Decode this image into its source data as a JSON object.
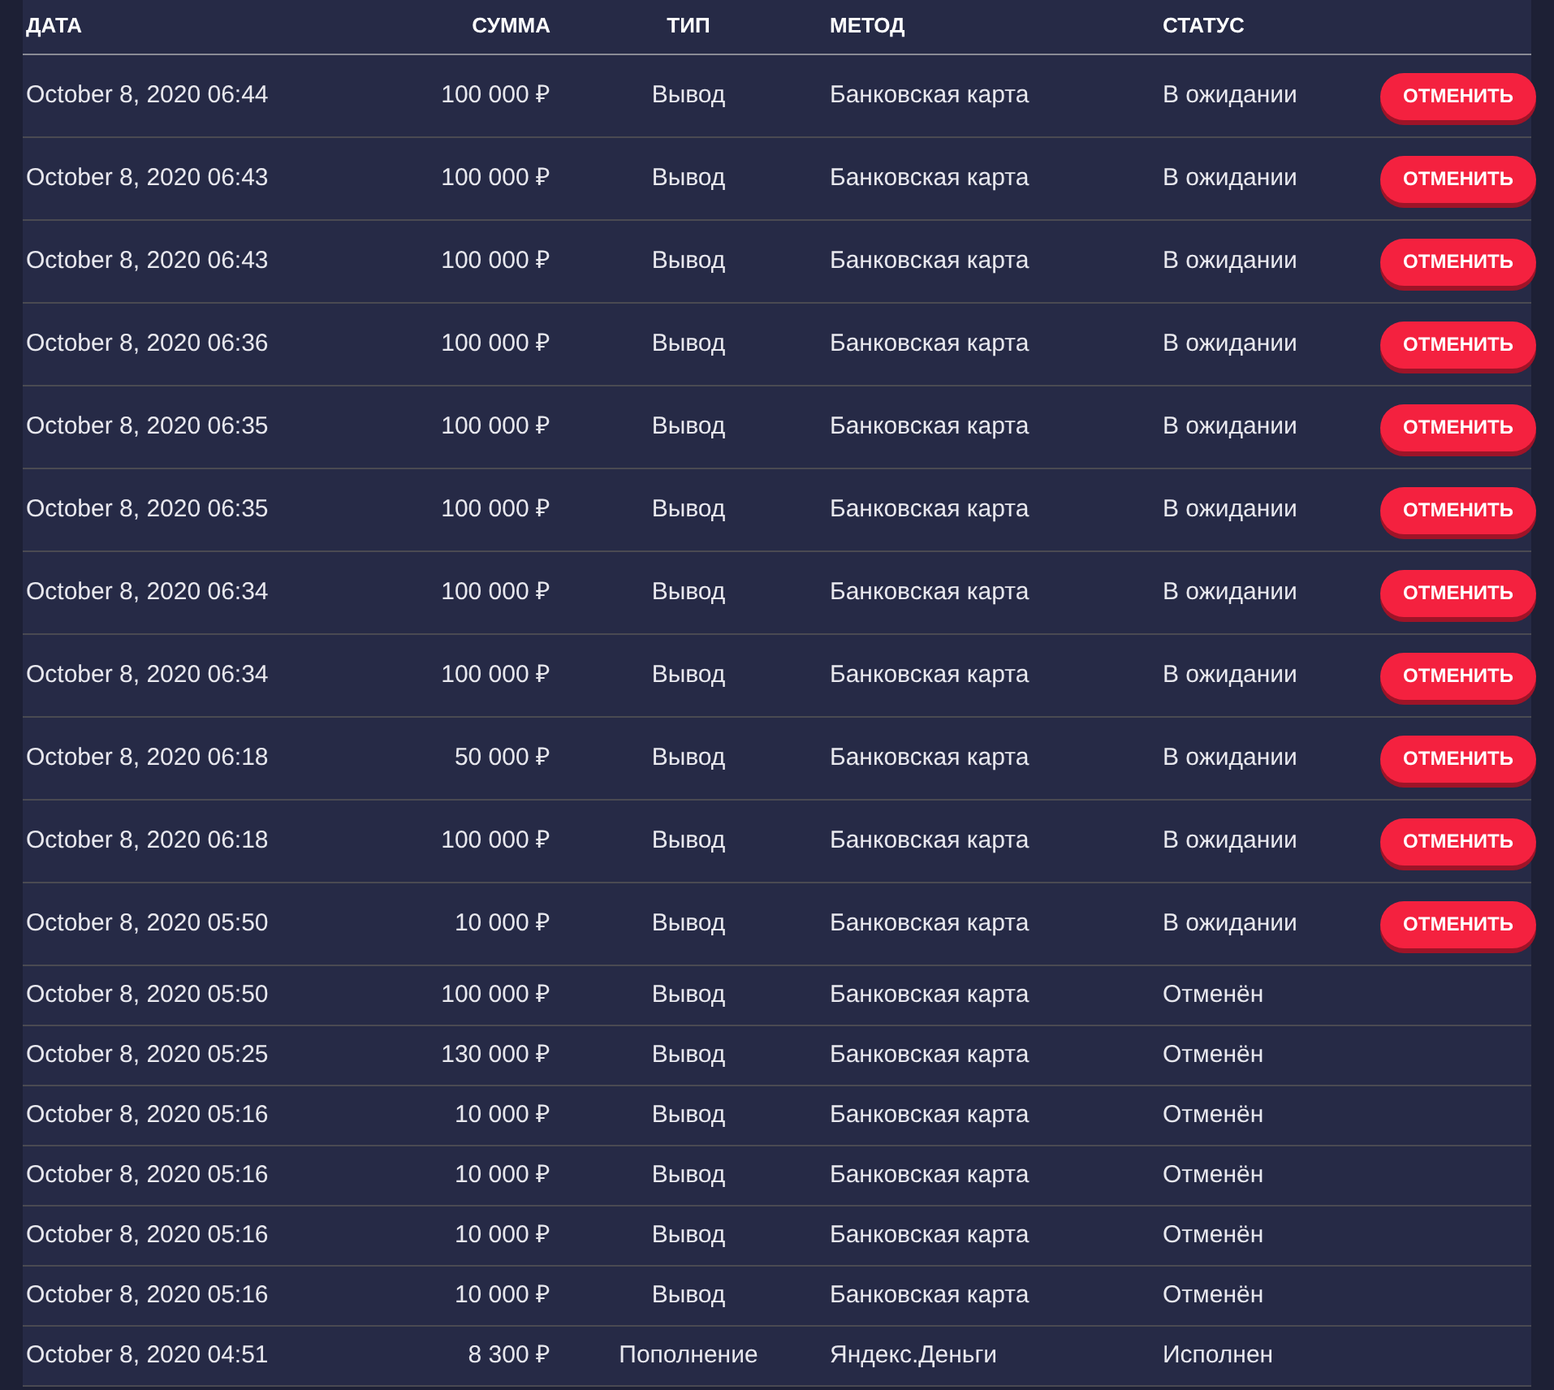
{
  "columns": [
    "ДАТА",
    "СУММА",
    "ТИП",
    "МЕТОД",
    "СТАТУС"
  ],
  "rows": [
    {
      "date": "October 8, 2020 06:44",
      "amount": "100 000 ₽",
      "type": "Вывод",
      "method": "Банковская карта",
      "status": "В ожидании",
      "action": "ОТМЕНИТЬ"
    },
    {
      "date": "October 8, 2020 06:43",
      "amount": "100 000 ₽",
      "type": "Вывод",
      "method": "Банковская карта",
      "status": "В ожидании",
      "action": "ОТМЕНИТЬ"
    },
    {
      "date": "October 8, 2020 06:43",
      "amount": "100 000 ₽",
      "type": "Вывод",
      "method": "Банковская карта",
      "status": "В ожидании",
      "action": "ОТМЕНИТЬ"
    },
    {
      "date": "October 8, 2020 06:36",
      "amount": "100 000 ₽",
      "type": "Вывод",
      "method": "Банковская карта",
      "status": "В ожидании",
      "action": "ОТМЕНИТЬ"
    },
    {
      "date": "October 8, 2020 06:35",
      "amount": "100 000 ₽",
      "type": "Вывод",
      "method": "Банковская карта",
      "status": "В ожидании",
      "action": "ОТМЕНИТЬ"
    },
    {
      "date": "October 8, 2020 06:35",
      "amount": "100 000 ₽",
      "type": "Вывод",
      "method": "Банковская карта",
      "status": "В ожидании",
      "action": "ОТМЕНИТЬ"
    },
    {
      "date": "October 8, 2020 06:34",
      "amount": "100 000 ₽",
      "type": "Вывод",
      "method": "Банковская карта",
      "status": "В ожидании",
      "action": "ОТМЕНИТЬ"
    },
    {
      "date": "October 8, 2020 06:34",
      "amount": "100 000 ₽",
      "type": "Вывод",
      "method": "Банковская карта",
      "status": "В ожидании",
      "action": "ОТМЕНИТЬ"
    },
    {
      "date": "October 8, 2020 06:18",
      "amount": "50 000 ₽",
      "type": "Вывод",
      "method": "Банковская карта",
      "status": "В ожидании",
      "action": "ОТМЕНИТЬ"
    },
    {
      "date": "October 8, 2020 06:18",
      "amount": "100 000 ₽",
      "type": "Вывод",
      "method": "Банковская карта",
      "status": "В ожидании",
      "action": "ОТМЕНИТЬ"
    },
    {
      "date": "October 8, 2020 05:50",
      "amount": "10 000 ₽",
      "type": "Вывод",
      "method": "Банковская карта",
      "status": "В ожидании",
      "action": "ОТМЕНИТЬ"
    },
    {
      "date": "October 8, 2020 05:50",
      "amount": "100 000 ₽",
      "type": "Вывод",
      "method": "Банковская карта",
      "status": "Отменён"
    },
    {
      "date": "October 8, 2020 05:25",
      "amount": "130 000 ₽",
      "type": "Вывод",
      "method": "Банковская карта",
      "status": "Отменён"
    },
    {
      "date": "October 8, 2020 05:16",
      "amount": "10 000 ₽",
      "type": "Вывод",
      "method": "Банковская карта",
      "status": "Отменён"
    },
    {
      "date": "October 8, 2020 05:16",
      "amount": "10 000 ₽",
      "type": "Вывод",
      "method": "Банковская карта",
      "status": "Отменён"
    },
    {
      "date": "October 8, 2020 05:16",
      "amount": "10 000 ₽",
      "type": "Вывод",
      "method": "Банковская карта",
      "status": "Отменён"
    },
    {
      "date": "October 8, 2020 05:16",
      "amount": "10 000 ₽",
      "type": "Вывод",
      "method": "Банковская карта",
      "status": "Отменён"
    },
    {
      "date": "October 8, 2020 04:51",
      "amount": "8 300 ₽",
      "type": "Пополнение",
      "method": "Яндекс.Деньги",
      "status": "Исполнен"
    }
  ]
}
